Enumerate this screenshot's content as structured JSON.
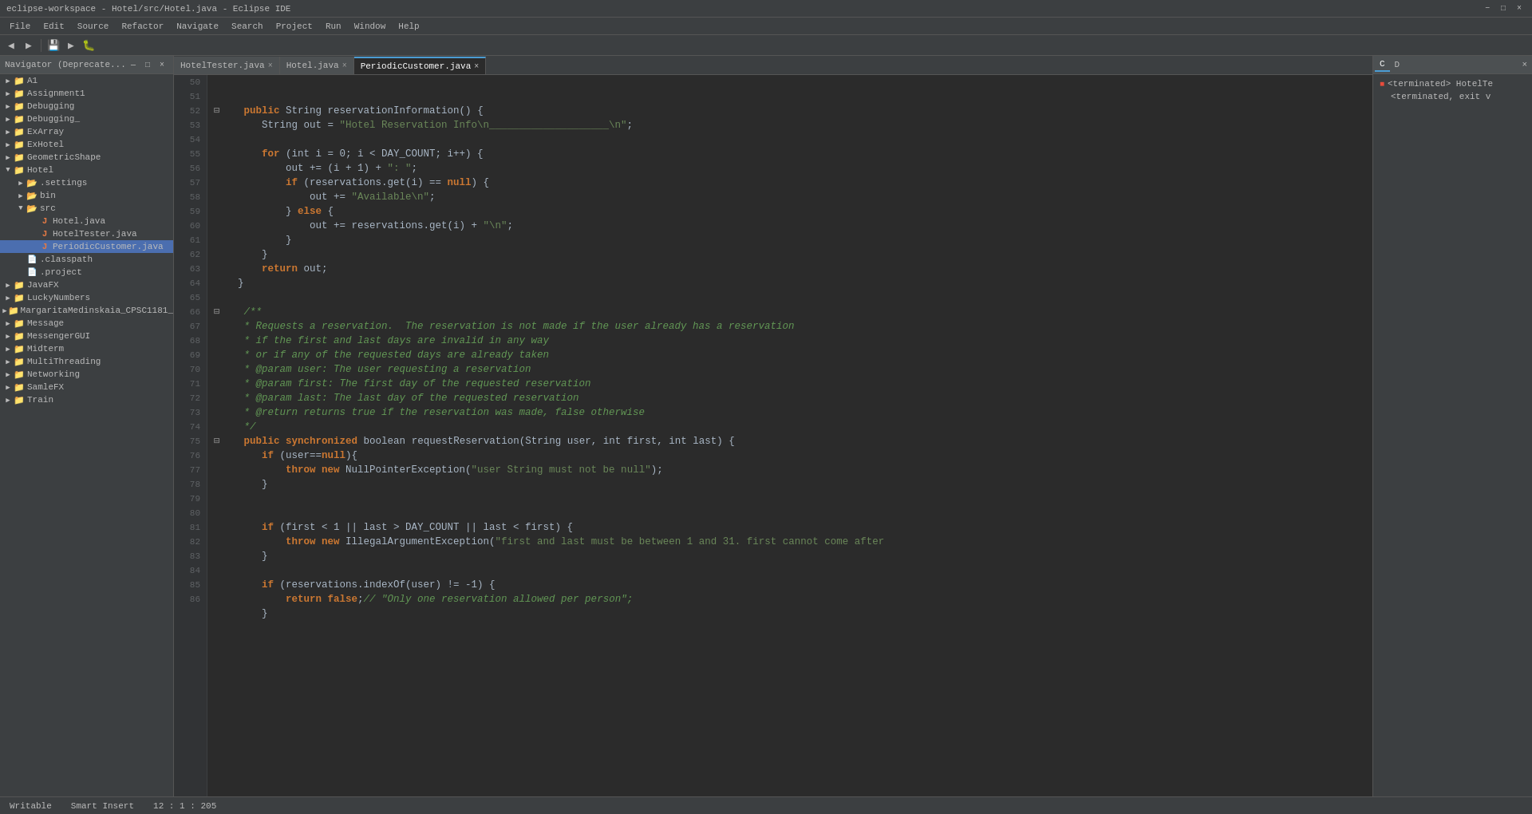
{
  "titleBar": {
    "title": "eclipse-workspace - Hotel/src/Hotel.java - Eclipse IDE",
    "minimizeLabel": "−",
    "maximizeLabel": "□",
    "closeLabel": "×"
  },
  "menuBar": {
    "items": [
      "File",
      "Edit",
      "Source",
      "Refactor",
      "Navigate",
      "Search",
      "Project",
      "Run",
      "Window",
      "Help"
    ]
  },
  "navigator": {
    "header": "Navigator (Deprecate...",
    "closeLabel": "×",
    "trees": [
      {
        "label": "A1",
        "type": "project",
        "indent": 0,
        "expanded": false
      },
      {
        "label": "Assignment1",
        "type": "project",
        "indent": 0,
        "expanded": false
      },
      {
        "label": "Debugging",
        "type": "project",
        "indent": 0,
        "expanded": false
      },
      {
        "label": "Debugging_",
        "type": "project",
        "indent": 0,
        "expanded": false
      },
      {
        "label": "ExArray",
        "type": "project",
        "indent": 0,
        "expanded": false
      },
      {
        "label": "ExHotel",
        "type": "project",
        "indent": 0,
        "expanded": false
      },
      {
        "label": "GeometricShape",
        "type": "project",
        "indent": 0,
        "expanded": false
      },
      {
        "label": "Hotel",
        "type": "project",
        "indent": 0,
        "expanded": true
      },
      {
        "label": ".settings",
        "type": "folder",
        "indent": 1,
        "expanded": false
      },
      {
        "label": "bin",
        "type": "folder",
        "indent": 1,
        "expanded": false
      },
      {
        "label": "src",
        "type": "folder",
        "indent": 1,
        "expanded": true
      },
      {
        "label": "Hotel.java",
        "type": "java",
        "indent": 2,
        "expanded": false
      },
      {
        "label": "HotelTester.java",
        "type": "java",
        "indent": 2,
        "expanded": false
      },
      {
        "label": "PeriodicCustomer.java",
        "type": "java",
        "indent": 2,
        "expanded": false,
        "selected": true
      },
      {
        "label": ".classpath",
        "type": "file",
        "indent": 1,
        "expanded": false
      },
      {
        "label": ".project",
        "type": "file",
        "indent": 1,
        "expanded": false
      },
      {
        "label": "JavaFX",
        "type": "project",
        "indent": 0,
        "expanded": false
      },
      {
        "label": "LuckyNumbers",
        "type": "project",
        "indent": 0,
        "expanded": false
      },
      {
        "label": "MargaritaMedinskaia_CPSC1181_",
        "type": "project",
        "indent": 0,
        "expanded": false
      },
      {
        "label": "Message",
        "type": "project",
        "indent": 0,
        "expanded": false
      },
      {
        "label": "MessengerGUI",
        "type": "project",
        "indent": 0,
        "expanded": false
      },
      {
        "label": "Midterm",
        "type": "project",
        "indent": 0,
        "expanded": false
      },
      {
        "label": "MultiThreading",
        "type": "project",
        "indent": 0,
        "expanded": false
      },
      {
        "label": "Networking",
        "type": "project",
        "indent": 0,
        "expanded": false
      },
      {
        "label": "SamleFX",
        "type": "project",
        "indent": 0,
        "expanded": false
      },
      {
        "label": "Train",
        "type": "project",
        "indent": 0,
        "expanded": false
      }
    ]
  },
  "tabs": [
    {
      "label": "HotelTester.java",
      "active": false
    },
    {
      "label": "Hotel.java",
      "active": false
    },
    {
      "label": "PeriodicCustomer.java",
      "active": true
    }
  ],
  "codeLines": [
    {
      "num": 50,
      "content": "⊞   public String reservationInformation() {"
    },
    {
      "num": 51,
      "content": "        String out = \"Hotel Reservation Info\\n____________________\\n\";"
    },
    {
      "num": 52,
      "content": ""
    },
    {
      "num": 53,
      "content": "        for (int i = 0; i < DAY_COUNT; i++) {"
    },
    {
      "num": 54,
      "content": "            out += (i + 1) + \": \";"
    },
    {
      "num": 55,
      "content": "            if (reservations.get(i) == null) {"
    },
    {
      "num": 56,
      "content": "                out += \"Available\\n\";"
    },
    {
      "num": 57,
      "content": "            } else {"
    },
    {
      "num": 58,
      "content": "                out += reservations.get(i) + \"\\n\";"
    },
    {
      "num": 59,
      "content": "            }"
    },
    {
      "num": 60,
      "content": "        }"
    },
    {
      "num": 61,
      "content": "        return out;"
    },
    {
      "num": 62,
      "content": "    }"
    },
    {
      "num": 63,
      "content": ""
    },
    {
      "num": 64,
      "content": "⊞   /**"
    },
    {
      "num": 65,
      "content": "     * Requests a reservation.  The reservation is not made if the user already has a reservation"
    },
    {
      "num": 66,
      "content": "     * if the first and last days are invalid in any way"
    },
    {
      "num": 67,
      "content": "     * or if any of the requested days are already taken"
    },
    {
      "num": 68,
      "content": "     * @param user: The user requesting a reservation"
    },
    {
      "num": 69,
      "content": "     * @param first: The first day of the requested reservation"
    },
    {
      "num": 70,
      "content": "     * @param last: The last day of the requested reservation"
    },
    {
      "num": 71,
      "content": "     * @return returns true if the reservation was made, false otherwise"
    },
    {
      "num": 72,
      "content": "     */"
    },
    {
      "num": 73,
      "content": "⊞   public synchronized boolean requestReservation(String user, int first, int last) {"
    },
    {
      "num": 74,
      "content": "        if (user==null){"
    },
    {
      "num": 75,
      "content": "            throw new NullPointerException(\"user String must not be null\");"
    },
    {
      "num": 76,
      "content": "        }"
    },
    {
      "num": 77,
      "content": ""
    },
    {
      "num": 78,
      "content": ""
    },
    {
      "num": 79,
      "content": "        if (first < 1 || last > DAY_COUNT || last < first) {"
    },
    {
      "num": 80,
      "content": "            throw new IllegalArgumentException(\"first and last must be between 1 and 31. first cannot come after"
    },
    {
      "num": 81,
      "content": "        }"
    },
    {
      "num": 82,
      "content": ""
    },
    {
      "num": 83,
      "content": "        if (reservations.indexOf(user) != -1) {"
    },
    {
      "num": 84,
      "content": "            return false;// \"Only one reservation allowed per person\";"
    },
    {
      "num": 85,
      "content": "        }"
    },
    {
      "num": 86,
      "content": ""
    }
  ],
  "statusBar": {
    "writable": "Writable",
    "insertMode": "Smart Insert",
    "position": "12 : 1 : 205"
  },
  "rightPanel": {
    "tabs": [
      "C",
      "D",
      "×"
    ],
    "terminatedLabel": "<terminated> HotelTe",
    "terminatedLabel2": "<terminated, exit v"
  }
}
